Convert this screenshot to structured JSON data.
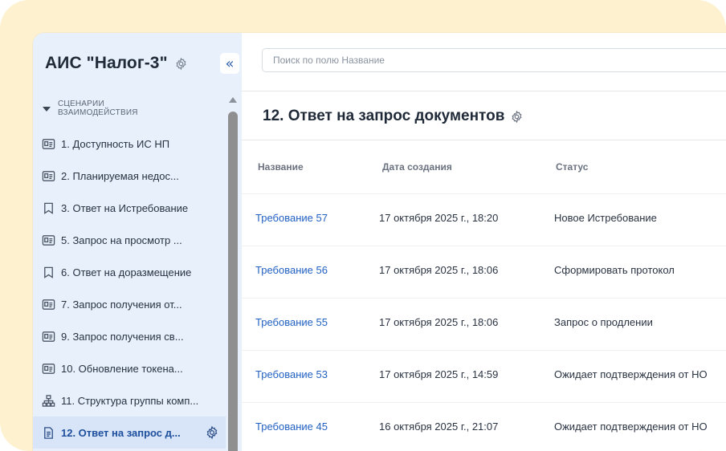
{
  "sidebar": {
    "app_title": "АИС \"Налог-3\"",
    "collapse_label": "«",
    "section_label": "СЦЕНАРИИ ВЗАИМОДЕЙСТВИЯ",
    "items": [
      {
        "label": "1. Доступность ИС НП",
        "icon": "id-card-icon"
      },
      {
        "label": "2. Планируемая недос...",
        "icon": "id-card-icon"
      },
      {
        "label": "3. Ответ на Истребование",
        "icon": "bookmark-icon"
      },
      {
        "label": "5. Запрос на просмотр ...",
        "icon": "id-card-icon"
      },
      {
        "label": "6. Ответ на доразмещение",
        "icon": "bookmark-icon"
      },
      {
        "label": "7. Запрос получения от...",
        "icon": "id-card-icon"
      },
      {
        "label": "9. Запрос получения св...",
        "icon": "id-card-icon"
      },
      {
        "label": "10. Обновление токена...",
        "icon": "id-card-icon"
      },
      {
        "label": "11. Структура группы комп...",
        "icon": "hierarchy-icon"
      },
      {
        "label": "12. Ответ на запрос д...",
        "icon": "document-icon",
        "active": true
      }
    ]
  },
  "search": {
    "placeholder": "Поиск по полю Название"
  },
  "page": {
    "title": "12. Ответ на запрос документов"
  },
  "table": {
    "columns": [
      "Название",
      "Дата создания",
      "Статус"
    ],
    "rows": [
      {
        "name": "Требование 57",
        "date": "17 октября 2025 г., 18:20",
        "status": "Новое Истребование"
      },
      {
        "name": "Требование 56",
        "date": "17 октября 2025 г., 18:06",
        "status": "Сформировать протокол"
      },
      {
        "name": "Требование 55",
        "date": "17 октября 2025 г., 18:06",
        "status": "Запрос о продлении"
      },
      {
        "name": "Требование 53",
        "date": "17 октября 2025 г., 14:59",
        "status": "Ожидает подтверждения от НО"
      },
      {
        "name": "Требование 45",
        "date": "16 октября 2025 г., 21:07",
        "status": "Ожидает подтверждения от НО"
      }
    ]
  },
  "colors": {
    "background": "#fdf1cf",
    "sidebar": "#e8f0fb",
    "link": "#2261c2",
    "active_item": "#d8e4f7"
  }
}
